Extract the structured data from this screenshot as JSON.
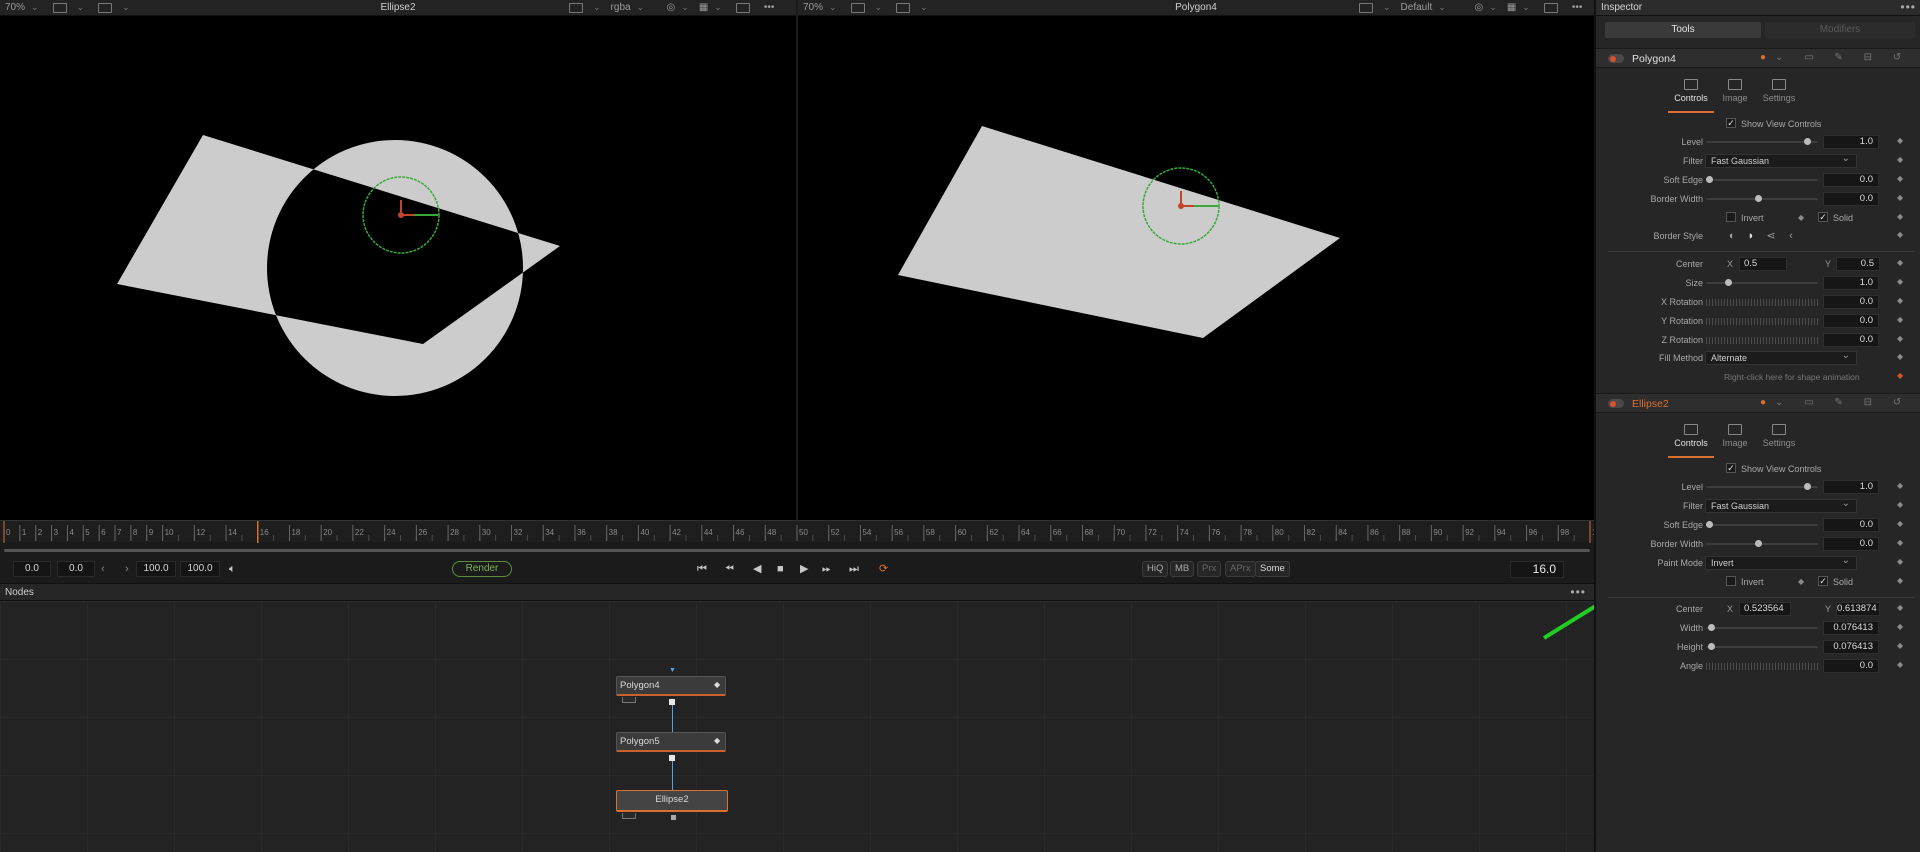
{
  "viewer_left": {
    "title": "Ellipse2",
    "zoom": "70%",
    "channel": "rgba"
  },
  "viewer_right": {
    "title": "Polygon4",
    "zoom": "70%",
    "lut": "Default"
  },
  "toolbar_more": "•••",
  "timeline": {
    "ticks": [
      "0",
      "1",
      "2",
      "3",
      "4",
      "5",
      "6",
      "7",
      "8",
      "9",
      "10",
      "12",
      "14",
      "16",
      "18",
      "20",
      "22",
      "24",
      "26",
      "28",
      "30",
      "32",
      "34",
      "36",
      "38",
      "40",
      "42",
      "44",
      "46",
      "48",
      "50",
      "52",
      "54",
      "56",
      "58",
      "60",
      "62",
      "64",
      "66",
      "68",
      "70",
      "72",
      "74",
      "76",
      "78",
      "80",
      "82",
      "84",
      "86",
      "88",
      "90",
      "92",
      "94",
      "96",
      "98",
      "100"
    ]
  },
  "transport": {
    "global_start": "0.0",
    "render_start": "0.0",
    "render_end": "100.0",
    "global_end": "100.0",
    "render_label": "Render",
    "hiq": "HiQ",
    "mb": "MB",
    "prx": "Prx",
    "apr": "APrx",
    "some": "Some",
    "current_frame": "16.0"
  },
  "nodes": {
    "title": "Nodes",
    "more": "•••",
    "items": [
      {
        "label": "Polygon4"
      },
      {
        "label": "Polygon5"
      },
      {
        "label": "Ellipse2"
      }
    ]
  },
  "inspector": {
    "title": "Inspector",
    "more": "•••",
    "tabs": {
      "tools": "Tools",
      "modifiers": "Modifiers"
    },
    "subtabs": {
      "controls": "Controls",
      "image": "Image",
      "settings": "Settings"
    },
    "polygon": {
      "name": "Polygon4",
      "show_view_controls": "Show View Controls",
      "level_label": "Level",
      "level": "1.0",
      "filter_label": "Filter",
      "filter": "Fast Gaussian",
      "soft_edge_label": "Soft Edge",
      "soft_edge": "0.0",
      "border_width_label": "Border Width",
      "border_width": "0.0",
      "invert_label": "Invert",
      "solid_label": "Solid",
      "border_style_label": "Border Style",
      "center_label": "Center",
      "center_x": "0.5",
      "center_y": "0.5",
      "x_label": "X",
      "y_label": "Y",
      "size_label": "Size",
      "size": "1.0",
      "x_rotation_label": "X Rotation",
      "x_rotation": "0.0",
      "y_rotation_label": "Y Rotation",
      "y_rotation": "0.0",
      "z_rotation_label": "Z Rotation",
      "z_rotation": "0.0",
      "fill_method_label": "Fill Method",
      "fill_method": "Alternate",
      "hint": "Right-click here for shape animation"
    },
    "ellipse": {
      "name": "Ellipse2",
      "show_view_controls": "Show View Controls",
      "level_label": "Level",
      "level": "1.0",
      "filter_label": "Filter",
      "filter": "Fast Gaussian",
      "soft_edge_label": "Soft Edge",
      "soft_edge": "0.0",
      "border_width_label": "Border Width",
      "border_width": "0.0",
      "paint_mode_label": "Paint Mode",
      "paint_mode": "Invert",
      "invert_label": "Invert",
      "solid_label": "Solid",
      "center_label": "Center",
      "center_x": "0.523564",
      "center_y": "0.613874",
      "x_label": "X",
      "y_label": "Y",
      "width_label": "Width",
      "width": "0.076413",
      "height_label": "Height",
      "height": "0.076413",
      "angle_label": "Angle",
      "angle": "0.0"
    }
  },
  "colors": {
    "accent_orange": "#d9702f",
    "node_link_blue": "#5aa0e0",
    "render_green": "#7fb256",
    "annotation_green": "#22cc22"
  }
}
